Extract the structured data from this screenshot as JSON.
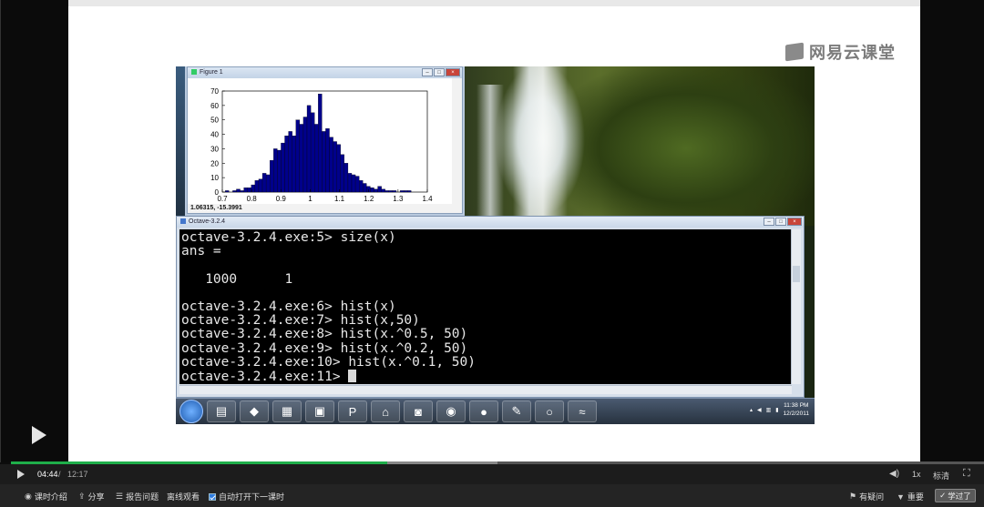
{
  "brand": "网易云课堂",
  "figure_window": {
    "title": "Figure 1",
    "coordinate_readout": "1.06315, -15.3991"
  },
  "chart_data": {
    "type": "bar",
    "title": "",
    "xlabel": "",
    "ylabel": "",
    "xlim": [
      0.7,
      1.4
    ],
    "ylim": [
      0,
      70
    ],
    "x_ticks": [
      "0.7",
      "0.8",
      "0.9",
      "1",
      "1.1",
      "1.2",
      "1.3",
      "1.4"
    ],
    "y_ticks": [
      "0",
      "10",
      "20",
      "30",
      "40",
      "50",
      "60",
      "70"
    ],
    "bin_start": 0.71,
    "bin_width": 0.0127,
    "values": [
      1,
      0,
      1,
      2,
      1,
      3,
      3,
      5,
      8,
      9,
      13,
      12,
      22,
      30,
      29,
      34,
      39,
      42,
      39,
      50,
      47,
      52,
      60,
      55,
      47,
      68,
      42,
      44,
      38,
      35,
      33,
      26,
      20,
      13,
      12,
      11,
      8,
      6,
      4,
      3,
      2,
      4,
      2,
      1,
      1,
      1,
      0,
      1,
      1,
      1
    ],
    "color": "#00008b"
  },
  "octave_window": {
    "title": "Octave-3.2.4",
    "lines": [
      "octave-3.2.4.exe:5> size(x)",
      "ans =",
      "",
      "   1000      1",
      "",
      "octave-3.2.4.exe:6> hist(x)",
      "octave-3.2.4.exe:7> hist(x,50)",
      "octave-3.2.4.exe:8> hist(x.^0.5, 50)",
      "octave-3.2.4.exe:9> hist(x.^0.2, 50)",
      "octave-3.2.4.exe:10> hist(x.^0.1, 50)"
    ],
    "prompt": "octave-3.2.4.exe:11> "
  },
  "taskbar": {
    "clock_time": "11:38 PM",
    "clock_date": "12/2/2011"
  },
  "player": {
    "current_time": "04:44",
    "separator": "/",
    "total_time": "12:17",
    "progress_fraction": 0.387,
    "buffer_fraction": 0.5,
    "speed_label": "1x",
    "quality_label": "标清"
  },
  "bottom_bar": {
    "intro_label": "课时介绍",
    "share_label": "分享",
    "report_label": "报告问题",
    "offline_label": "离线观看",
    "autoplay_label": "自动打开下一课时",
    "question_label": "有疑问",
    "important_label": "重要",
    "learned_label": "学过了"
  }
}
